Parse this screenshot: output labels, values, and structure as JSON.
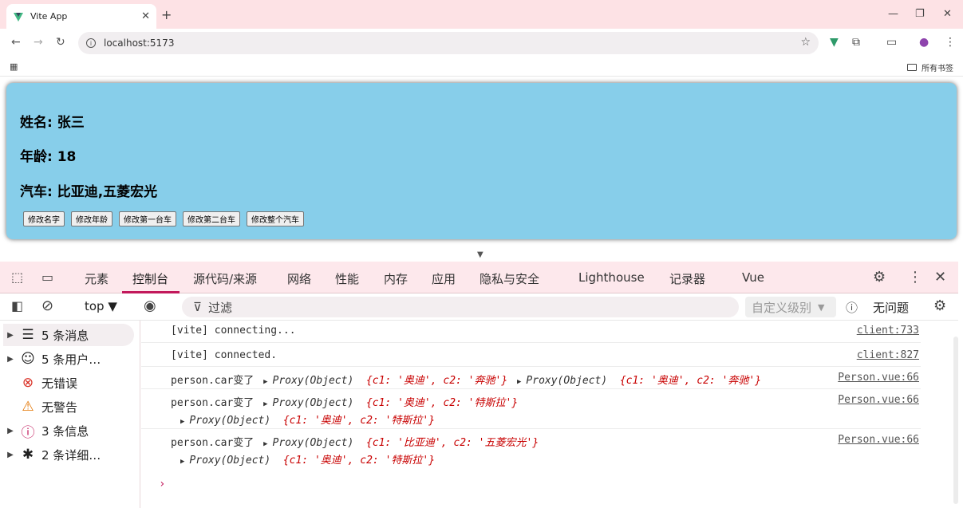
{
  "browser": {
    "tab_title": "Vite App",
    "tab_close": "✕",
    "new_tab": "+",
    "url": "localhost:5173",
    "all_bookmarks": "所有书签"
  },
  "page": {
    "name_line": "姓名: 张三",
    "age_line": "年龄: 18",
    "car_line": "汽车: 比亚迪,五菱宏光",
    "buttons": [
      "修改名字",
      "修改年龄",
      "修改第一台车",
      "修改第二台车",
      "修改整个汽车"
    ],
    "card_color": "#87ceea"
  },
  "devtools": {
    "tabs": [
      "元素",
      "控制台",
      "源代码/来源",
      "网络",
      "性能",
      "内存",
      "应用",
      "隐私与安全",
      "Lighthouse",
      "记录器",
      "Vue"
    ],
    "active_tab": "控制台",
    "context": "top",
    "filter_placeholder": "过滤",
    "level": "自定义级别",
    "issues": "无问题",
    "sidebar": [
      {
        "label": "5 条消息",
        "icon": "list-icon",
        "expandable": true
      },
      {
        "label": "5 条用户…",
        "icon": "user-icon",
        "expandable": true
      },
      {
        "label": "无错误",
        "icon": "error-icon",
        "expandable": false
      },
      {
        "label": "无警告",
        "icon": "warning-icon",
        "expandable": false
      },
      {
        "label": "3 条信息",
        "icon": "info-icon",
        "expandable": true
      },
      {
        "label": "2 条详细…",
        "icon": "bug-icon",
        "expandable": true
      }
    ],
    "messages": [
      {
        "text": "[vite] connecting...",
        "source": "client:733"
      },
      {
        "text": "[vite] connected.",
        "source": "client:827"
      },
      {
        "prefix": "person.car变了",
        "source": "Person.vue:66",
        "a": {
          "label": "Proxy(Object)",
          "body": "{c1: '奥迪', c2: '奔驰'}"
        },
        "b": {
          "label": "Proxy(Object)",
          "body": "{c1: '奥迪', c2: '奔驰'}"
        }
      },
      {
        "prefix": "person.car变了",
        "source": "Person.vue:66",
        "a": {
          "label": "Proxy(Object)",
          "body": "{c1: '奥迪', c2: '特斯拉'}"
        },
        "b": {
          "label": "Proxy(Object)",
          "body": "{c1: '奥迪', c2: '特斯拉'}"
        }
      },
      {
        "prefix": "person.car变了",
        "source": "Person.vue:66",
        "a": {
          "label": "Proxy(Object)",
          "body": "{c1: '比亚迪', c2: '五菱宏光'}"
        },
        "b": {
          "label": "Proxy(Object)",
          "body": "{c1: '奥迪', c2: '特斯拉'}"
        }
      }
    ],
    "accent": "#c2185b"
  }
}
